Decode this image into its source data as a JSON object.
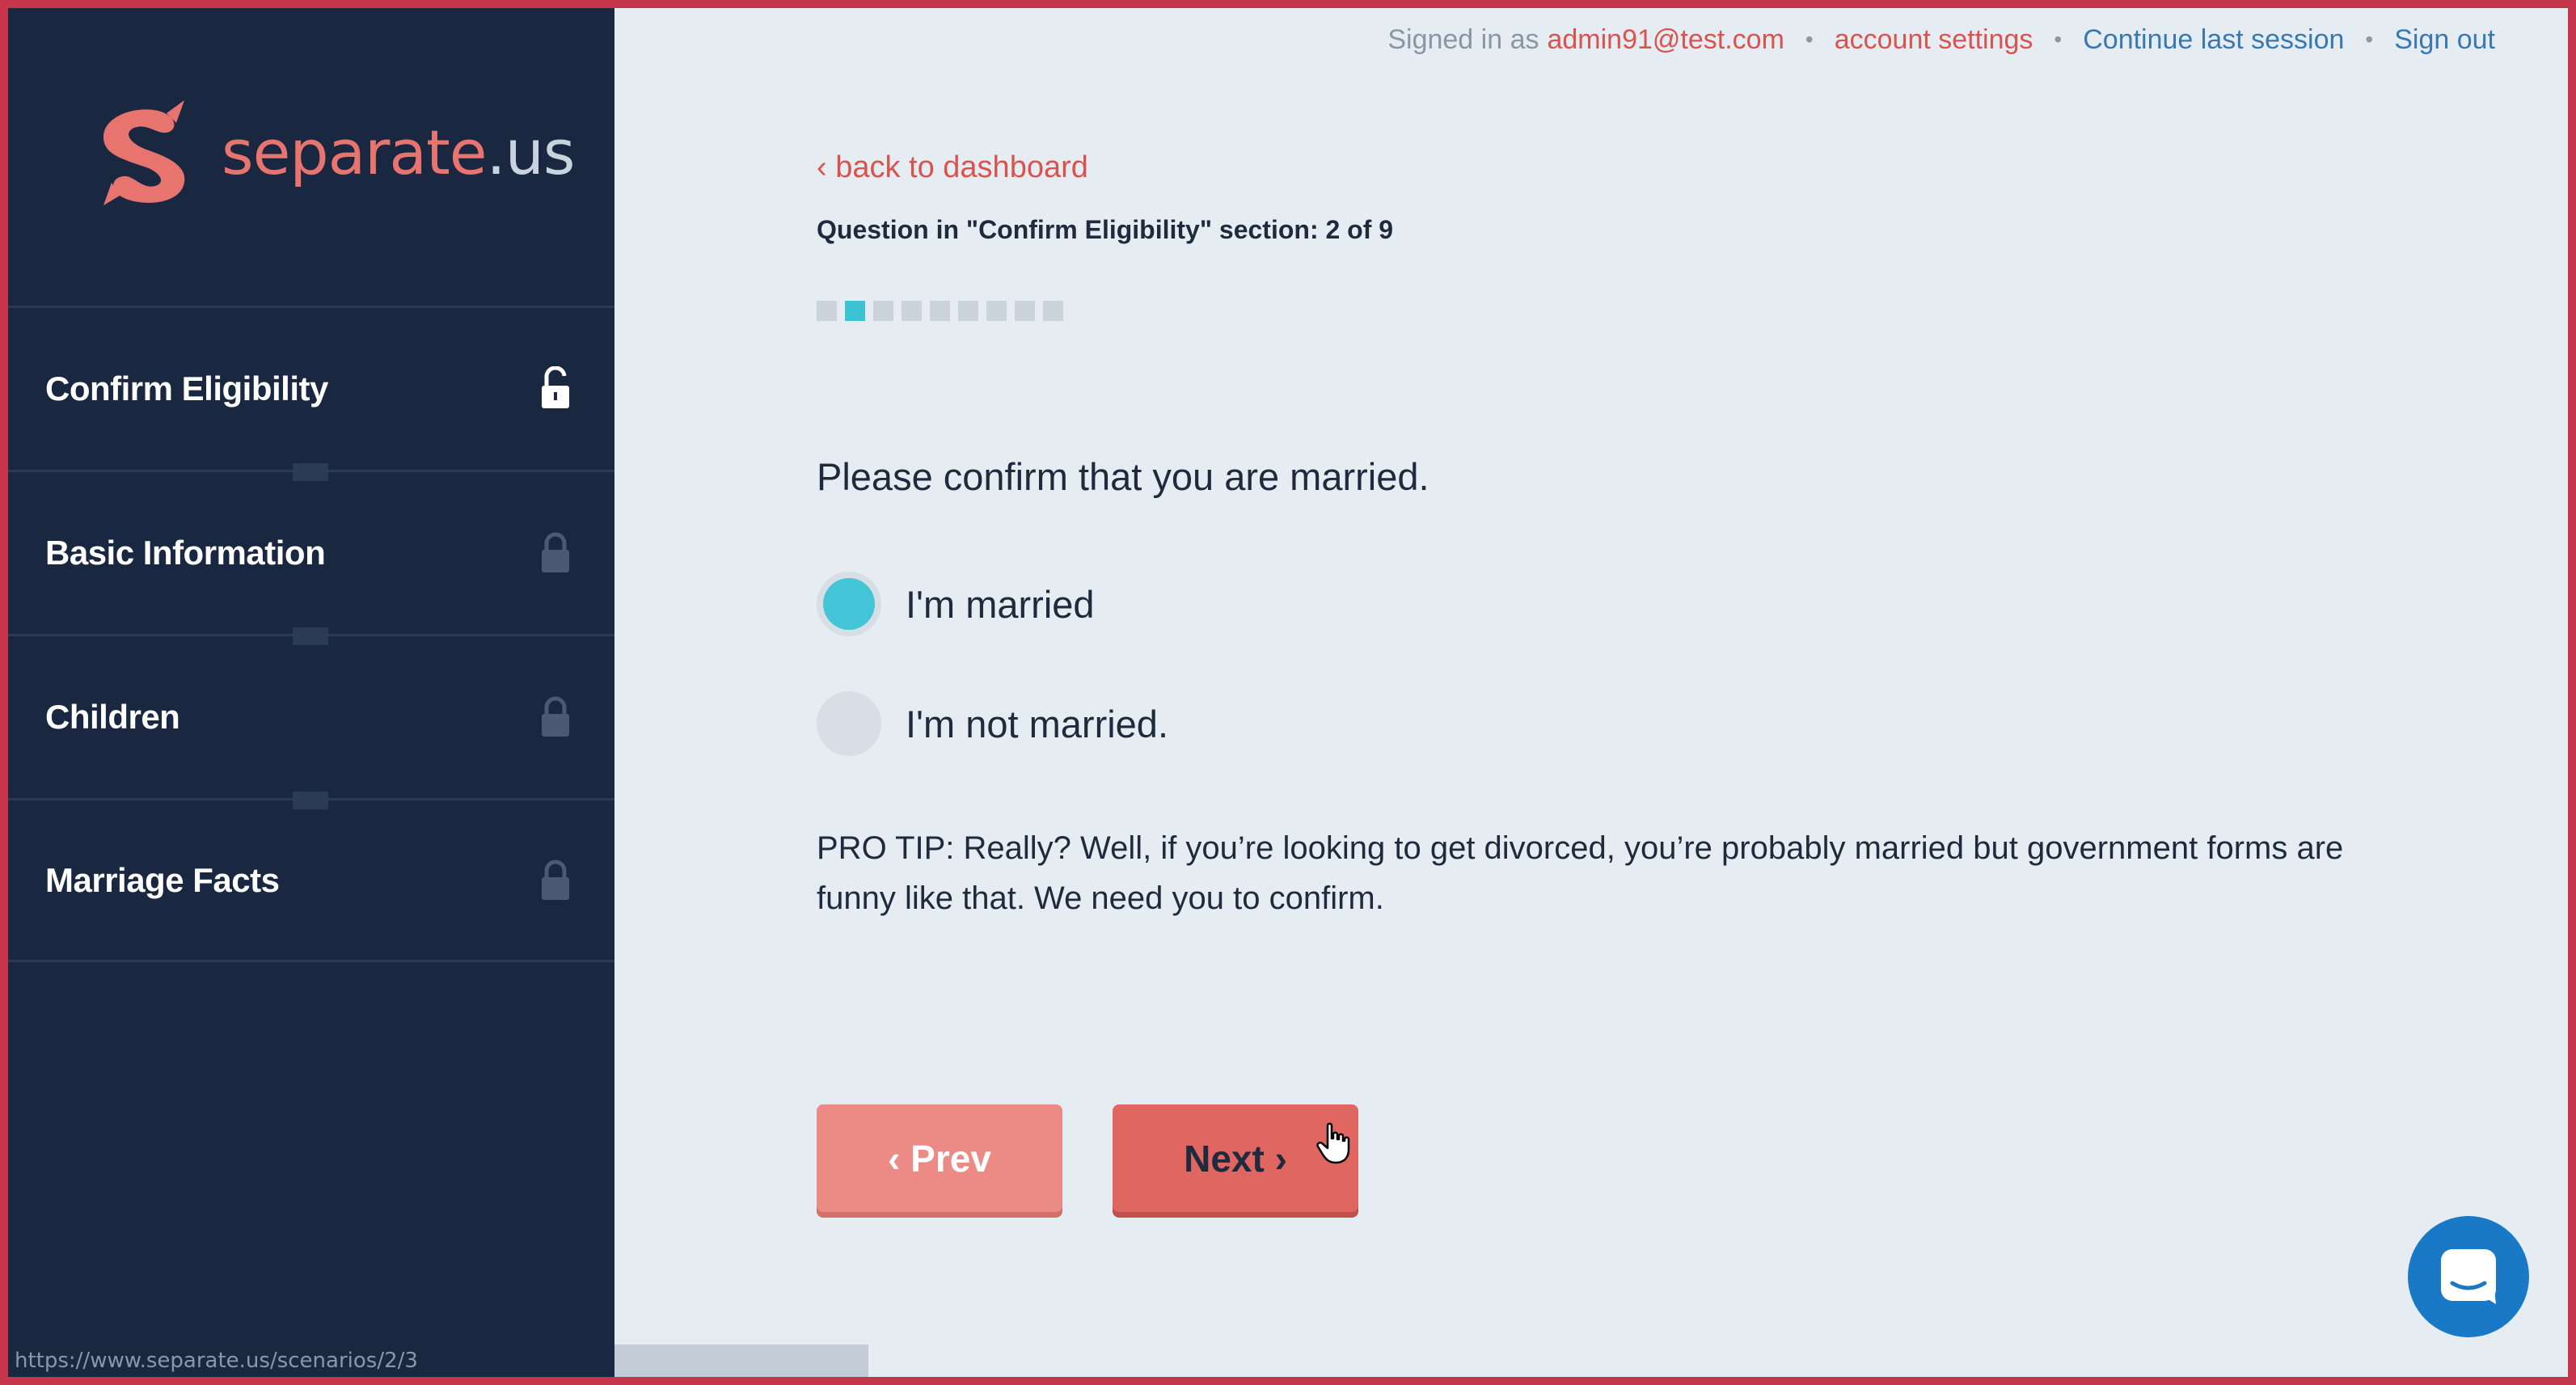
{
  "brand": {
    "name": "separate",
    "tld": ".us",
    "color": "#e87470"
  },
  "header": {
    "signed_in_prefix": "Signed in as",
    "user_email": "admin91@test.com",
    "account_settings": "account settings",
    "continue_session": "Continue last session",
    "sign_out": "Sign out"
  },
  "sidebar": {
    "items": [
      {
        "label": "Confirm Eligibility",
        "lock": "unlocked-icon"
      },
      {
        "label": "Basic Information",
        "lock": "lock-icon"
      },
      {
        "label": "Children",
        "lock": "lock-icon"
      },
      {
        "label": "Marriage Facts",
        "lock": "lock-icon"
      }
    ]
  },
  "main": {
    "back_link": "‹ back to dashboard",
    "question_meta": "Question in \"Confirm Eligibility\" section: 2 of 9",
    "progress": {
      "current": 2,
      "total": 9
    },
    "question": "Please confirm that you are married.",
    "options": [
      {
        "label": "I'm married",
        "selected": true
      },
      {
        "label": "I'm not married.",
        "selected": false
      }
    ],
    "pro_tip": "PRO TIP: Really? Well, if you’re looking to get divorced, you’re probably married but government forms are funny like that. We need you to confirm.",
    "prev_label": "‹ Prev",
    "next_label": "Next ›"
  },
  "status_url": "https://www.separate.us/scenarios/2/3",
  "colors": {
    "sidebar_bg": "#1a2740",
    "accent_red": "#d9534f",
    "accent_blue": "#3a79b0",
    "radio_selected": "#43c4d7",
    "chat_button": "#1979c6"
  }
}
